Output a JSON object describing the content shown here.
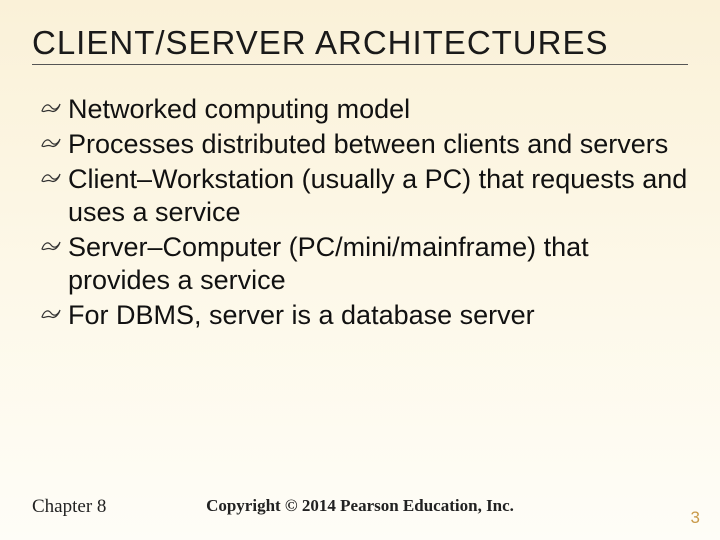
{
  "title": "CLIENT/SERVER ARCHITECTURES",
  "bullets": [
    "Networked computing model",
    "Processes distributed between clients and servers",
    "Client–Workstation (usually a PC) that requests and uses a service",
    "Server–Computer (PC/mini/mainframe) that provides a service",
    "For DBMS, server is a database server"
  ],
  "footer": {
    "chapter": "Chapter 8",
    "copyright": "Copyright © 2014 Pearson Education, Inc.",
    "page": "3"
  },
  "icon_name": "scribble-bullet-icon"
}
